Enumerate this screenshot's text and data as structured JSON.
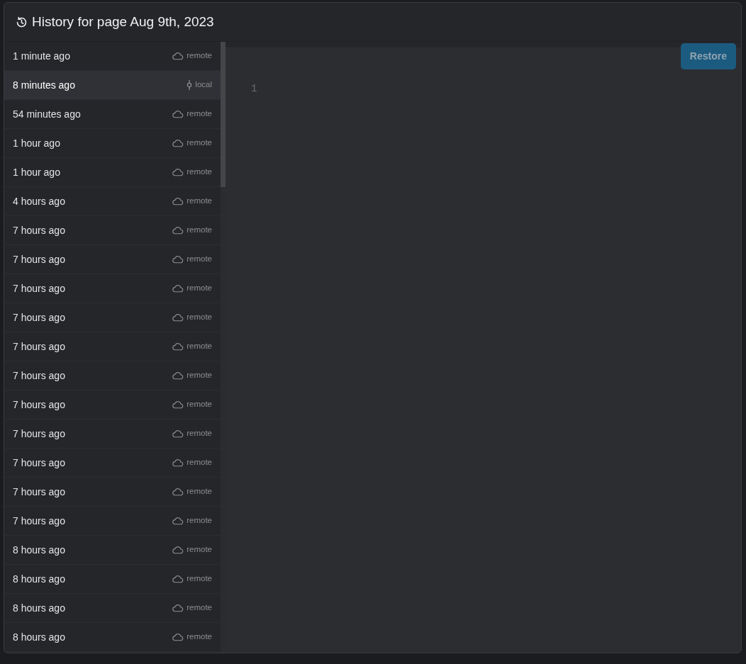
{
  "dialog": {
    "title": "History for page Aug 9th, 2023"
  },
  "versions": [
    {
      "time": "1 minute ago",
      "kind": "remote",
      "label": "remote",
      "selected": false
    },
    {
      "time": "8 minutes ago",
      "kind": "local",
      "label": "local",
      "selected": true
    },
    {
      "time": "54 minutes ago",
      "kind": "remote",
      "label": "remote",
      "selected": false
    },
    {
      "time": "1 hour ago",
      "kind": "remote",
      "label": "remote",
      "selected": false
    },
    {
      "time": "1 hour ago",
      "kind": "remote",
      "label": "remote",
      "selected": false
    },
    {
      "time": "4 hours ago",
      "kind": "remote",
      "label": "remote",
      "selected": false
    },
    {
      "time": "7 hours ago",
      "kind": "remote",
      "label": "remote",
      "selected": false
    },
    {
      "time": "7 hours ago",
      "kind": "remote",
      "label": "remote",
      "selected": false
    },
    {
      "time": "7 hours ago",
      "kind": "remote",
      "label": "remote",
      "selected": false
    },
    {
      "time": "7 hours ago",
      "kind": "remote",
      "label": "remote",
      "selected": false
    },
    {
      "time": "7 hours ago",
      "kind": "remote",
      "label": "remote",
      "selected": false
    },
    {
      "time": "7 hours ago",
      "kind": "remote",
      "label": "remote",
      "selected": false
    },
    {
      "time": "7 hours ago",
      "kind": "remote",
      "label": "remote",
      "selected": false
    },
    {
      "time": "7 hours ago",
      "kind": "remote",
      "label": "remote",
      "selected": false
    },
    {
      "time": "7 hours ago",
      "kind": "remote",
      "label": "remote",
      "selected": false
    },
    {
      "time": "7 hours ago",
      "kind": "remote",
      "label": "remote",
      "selected": false
    },
    {
      "time": "7 hours ago",
      "kind": "remote",
      "label": "remote",
      "selected": false
    },
    {
      "time": "8 hours ago",
      "kind": "remote",
      "label": "remote",
      "selected": false
    },
    {
      "time": "8 hours ago",
      "kind": "remote",
      "label": "remote",
      "selected": false
    },
    {
      "time": "8 hours ago",
      "kind": "remote",
      "label": "remote",
      "selected": false
    },
    {
      "time": "8 hours ago",
      "kind": "remote",
      "label": "remote",
      "selected": false
    }
  ],
  "restore_button": {
    "label": "Restore",
    "disabled": true
  },
  "editor": {
    "line_numbers": [
      "1"
    ]
  }
}
